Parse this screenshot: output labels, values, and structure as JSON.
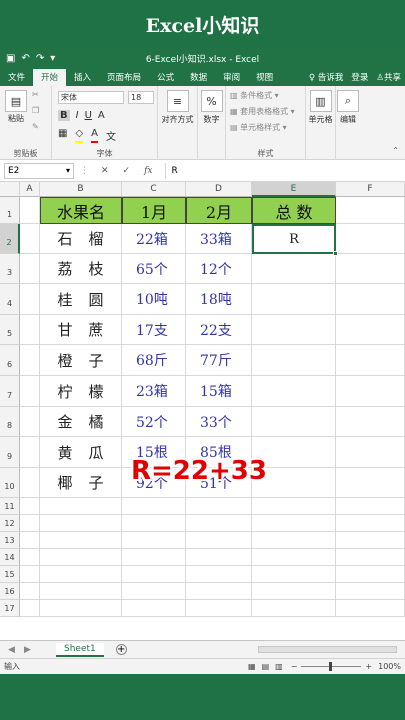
{
  "banner": {
    "title": "Excel小知识"
  },
  "window": {
    "doc_title": "6-Excel小知识.xlsx - Excel"
  },
  "ribbon_tabs": [
    "文件",
    "开始",
    "插入",
    "页面布局",
    "公式",
    "数据",
    "审阅",
    "视图"
  ],
  "tabs_right": {
    "tell_me": "告诉我",
    "login": "登录",
    "share": "共享"
  },
  "ribbon": {
    "paste": "粘贴",
    "clipboard": "剪贴板",
    "font_name": "宋体",
    "font_size": "18",
    "font_group": "字体",
    "align": "对齐方式",
    "number": "数字",
    "cond_format": "条件格式",
    "table_format": "套用表格格式",
    "cell_style": "单元格样式",
    "styles_group": "样式",
    "cells": "单元格",
    "editing": "编辑"
  },
  "formula_bar": {
    "name_box": "E2",
    "content": "R"
  },
  "columns": [
    "A",
    "B",
    "C",
    "D",
    "E",
    "F"
  ],
  "rows": [
    "1",
    "2",
    "3",
    "4",
    "5",
    "6",
    "7",
    "8",
    "9",
    "10",
    "11",
    "12",
    "13",
    "14",
    "15",
    "16",
    "17"
  ],
  "table": {
    "headers": [
      "水果名",
      "1月",
      "2月",
      "总 数"
    ],
    "rows": [
      {
        "name": "石榴",
        "jan": "22箱",
        "feb": "33箱",
        "total": "R"
      },
      {
        "name": "荔枝",
        "jan": "65个",
        "feb": "12个",
        "total": ""
      },
      {
        "name": "桂圆",
        "jan": "10吨",
        "feb": "18吨",
        "total": ""
      },
      {
        "name": "甘蔗",
        "jan": "17支",
        "feb": "22支",
        "total": ""
      },
      {
        "name": "橙子",
        "jan": "68斤",
        "feb": "77斤",
        "total": ""
      },
      {
        "name": "柠檬",
        "jan": "23箱",
        "feb": "15箱",
        "total": ""
      },
      {
        "name": "金橘",
        "jan": "52个",
        "feb": "33个",
        "total": ""
      },
      {
        "name": "黄瓜",
        "jan": "15根",
        "feb": "85根",
        "total": ""
      },
      {
        "name": "椰子",
        "jan": "92个",
        "feb": "51个",
        "total": ""
      }
    ]
  },
  "overlay": {
    "text": "R=22+33"
  },
  "sheet_tab": "Sheet1",
  "status": {
    "mode": "输入",
    "zoom": "100%"
  }
}
